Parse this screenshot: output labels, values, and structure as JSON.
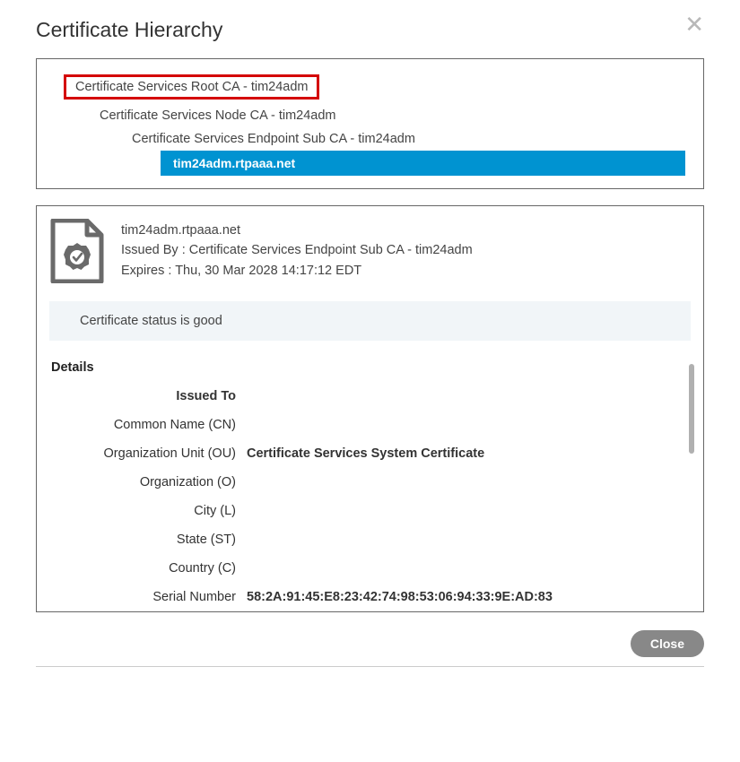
{
  "dialog": {
    "title": "Certificate Hierarchy",
    "close_button_label": "Close"
  },
  "hierarchy": {
    "items": [
      {
        "label": "Certificate Services Root CA - tim24adm",
        "level": 0,
        "highlighted": true
      },
      {
        "label": "Certificate Services Node CA - tim24adm",
        "level": 1
      },
      {
        "label": "Certificate Services Endpoint Sub CA - tim24adm",
        "level": 2
      },
      {
        "label": "tim24adm.rtpaaa.net",
        "level": 3,
        "selected": true
      }
    ]
  },
  "summary": {
    "subject": "tim24adm.rtpaaa.net",
    "issued_by_label": "Issued By : ",
    "issued_by": "Certificate Services Endpoint Sub CA - tim24adm",
    "expires_label": "Expires : ",
    "expires": "Thu, 30 Mar 2028 14:17:12 EDT"
  },
  "status": {
    "message": "Certificate status is good"
  },
  "details": {
    "heading": "Details",
    "section_issued_to": "Issued To",
    "rows": [
      {
        "label": "Common Name (CN)",
        "value": ""
      },
      {
        "label": "Organization Unit (OU)",
        "value": "Certificate Services System Certificate",
        "bold": true
      },
      {
        "label": "Organization (O)",
        "value": ""
      },
      {
        "label": "City (L)",
        "value": ""
      },
      {
        "label": "State (ST)",
        "value": ""
      },
      {
        "label": "Country (C)",
        "value": ""
      },
      {
        "label": "Serial Number",
        "value": "58:2A:91:45:E8:23:42:74:98:53:06:94:33:9E:AD:83",
        "bold": true
      }
    ]
  }
}
